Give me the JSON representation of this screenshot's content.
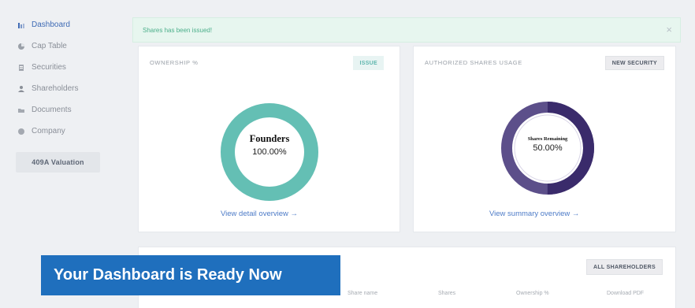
{
  "sidebar": {
    "items": [
      {
        "label": "Dashboard",
        "icon": "bar-chart-icon",
        "active": true
      },
      {
        "label": "Cap Table",
        "icon": "pie-chart-icon"
      },
      {
        "label": "Securities",
        "icon": "document-icon"
      },
      {
        "label": "Shareholders",
        "icon": "person-icon"
      },
      {
        "label": "Documents",
        "icon": "folder-icon"
      },
      {
        "label": "Company",
        "icon": "building-icon"
      }
    ],
    "valuation_label": "409A Valuation"
  },
  "alert": {
    "text": "Shares has been issued!",
    "close_icon": "close-icon"
  },
  "ownership_card": {
    "title": "OWNERSHIP %",
    "button_label": "ISSUE",
    "donut_label": "Founders",
    "donut_value": "100.00%",
    "donut_fraction": 1.0,
    "color": "#64bfb4",
    "link": "View detail overview →"
  },
  "authorized_card": {
    "title": "AUTHORIZED SHARES USAGE",
    "button_label": "NEW SECURITY",
    "donut_label": "Shares Remaining",
    "donut_value": "50.00%",
    "donut_fraction": 0.5,
    "color_remaining": "#3a2b6b",
    "color_used": "#5c4f8a",
    "link": "View summary overview →"
  },
  "shareholders_section": {
    "button_label": "ALL SHAREHOLDERS",
    "columns": [
      "Share name",
      "Shares",
      "Ownership %",
      "Download PDF"
    ]
  },
  "banner": {
    "text": "Your Dashboard is Ready Now",
    "color": "#1f6fbd"
  }
}
